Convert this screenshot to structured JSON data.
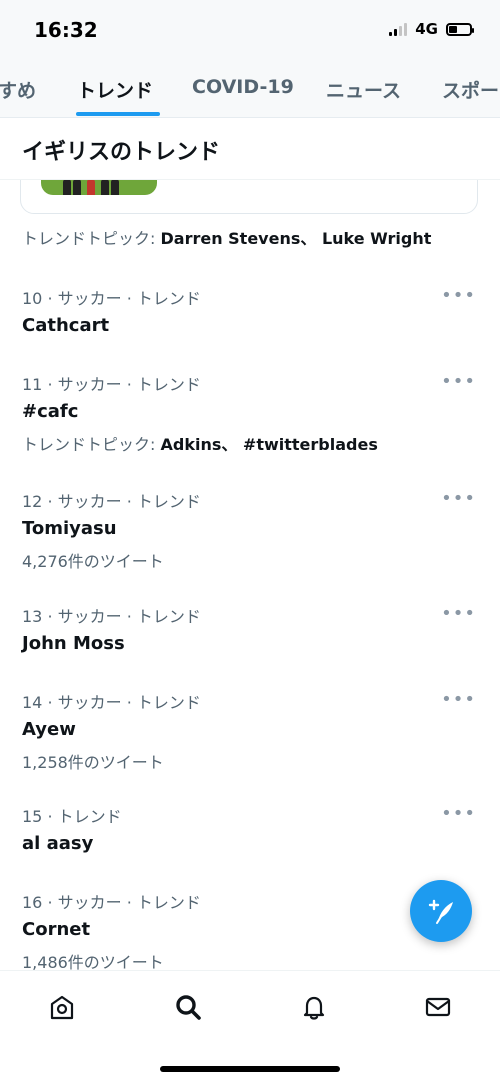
{
  "status": {
    "time": "16:32",
    "network": "4G"
  },
  "tabs": [
    {
      "label": "すめ"
    },
    {
      "label": "トレンド"
    },
    {
      "label": "COVID-19"
    },
    {
      "label": "ニュース"
    },
    {
      "label": "スポー"
    }
  ],
  "section": {
    "title": "イギリスのトレンド"
  },
  "topic_line": {
    "prefix": "トレンドトピック: ",
    "topics": "Darren Stevens、 Luke Wright"
  },
  "trends": [
    {
      "meta": "10 · サッカー · トレンド",
      "name": "Cathcart",
      "sub": ""
    },
    {
      "meta": "11 · サッカー · トレンド",
      "name": "#cafc",
      "sub_prefix": "トレンドトピック: ",
      "sub_bold": "Adkins、 #twitterblades"
    },
    {
      "meta": "12 · サッカー · トレンド",
      "name": "Tomiyasu",
      "sub": "4,276件のツイート"
    },
    {
      "meta": "13 · サッカー · トレンド",
      "name": "John Moss",
      "sub": ""
    },
    {
      "meta": "14 · サッカー · トレンド",
      "name": "Ayew",
      "sub": "1,258件のツイート"
    },
    {
      "meta": "15 · トレンド",
      "name": "al aasy",
      "sub": ""
    },
    {
      "meta": "16 · サッカー · トレンド",
      "name": "Cornet",
      "sub": "1,486件のツイート"
    }
  ],
  "more_glyph": "•••",
  "icons": {
    "fab": "compose-tweet-icon",
    "nav": [
      "home-icon",
      "search-icon",
      "notifications-icon",
      "messages-icon"
    ]
  },
  "colors": {
    "accent": "#1d9bf0",
    "secondary_text": "#536471"
  }
}
